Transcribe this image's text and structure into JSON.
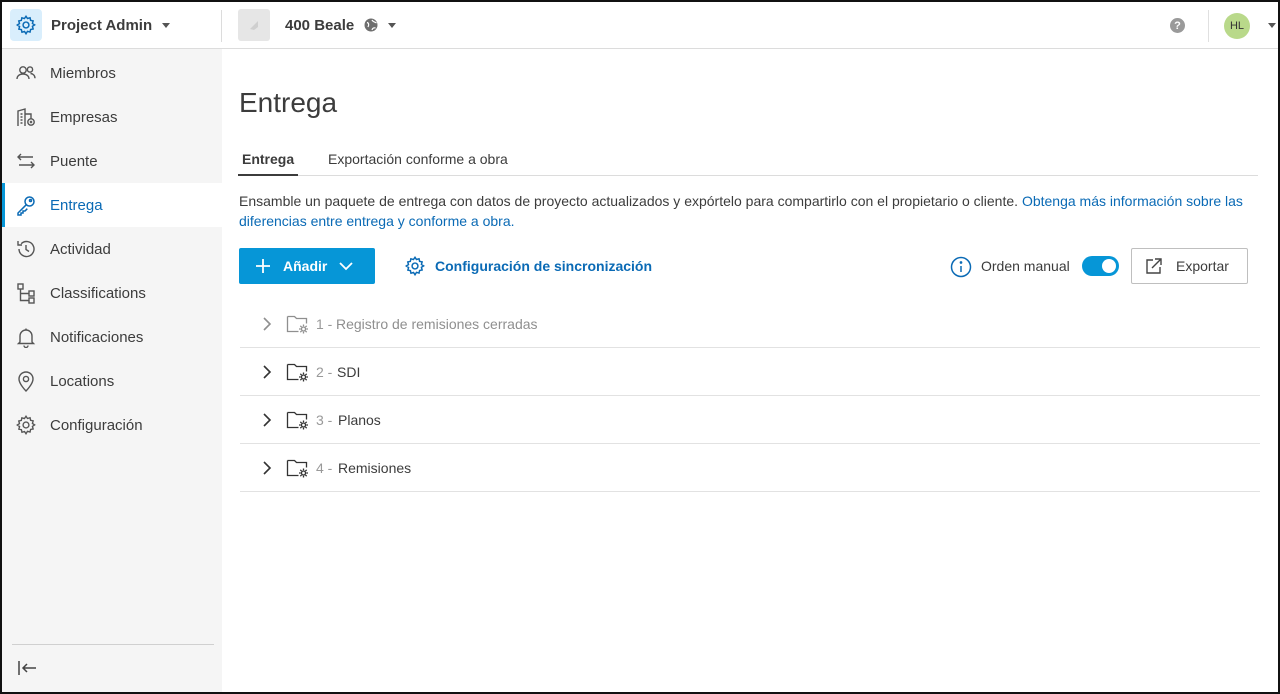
{
  "topbar": {
    "app_name": "Project Admin",
    "project_name": "400 Beale",
    "help_glyph": "?",
    "avatar_initials": "HL"
  },
  "sidebar": {
    "items": [
      {
        "label": "Miembros",
        "icon": "people-icon"
      },
      {
        "label": "Empresas",
        "icon": "building-icon"
      },
      {
        "label": "Puente",
        "icon": "bridge-arrows-icon"
      },
      {
        "label": "Entrega",
        "icon": "key-icon",
        "active": true
      },
      {
        "label": "Actividad",
        "icon": "history-icon"
      },
      {
        "label": "Classifications",
        "icon": "hierarchy-icon"
      },
      {
        "label": "Notificaciones",
        "icon": "bell-icon"
      },
      {
        "label": "Locations",
        "icon": "location-pin-icon"
      },
      {
        "label": "Configuración",
        "icon": "gear-icon"
      }
    ]
  },
  "main": {
    "title": "Entrega",
    "tabs": [
      {
        "label": "Entrega",
        "active": true
      },
      {
        "label": "Exportación conforme a obra",
        "active": false
      }
    ],
    "description": "Ensamble un paquete de entrega con datos de proyecto actualizados y expórtelo para compartirlo con el propietario o cliente. ",
    "description_link": "Obtenga más información sobre las diferencias entre entrega y conforme a obra.",
    "add_button": "Añadir",
    "sync_settings": "Configuración de sincronización",
    "manual_order_label": "Orden manual",
    "manual_order_on": true,
    "export_button": "Exportar",
    "folders": [
      {
        "num": "1 -",
        "name": "Registro de remisiones cerradas",
        "dimmed": true
      },
      {
        "num": "2 -",
        "name": "SDI",
        "dimmed": false
      },
      {
        "num": "3 -",
        "name": "Planos",
        "dimmed": false
      },
      {
        "num": "4 -",
        "name": "Remisiones",
        "dimmed": false
      }
    ]
  },
  "colors": {
    "accent": "#0696d7",
    "link": "#0a6ab5",
    "sidebar_bg": "#f5f5f5",
    "avatar_bg": "#b9d98a"
  }
}
